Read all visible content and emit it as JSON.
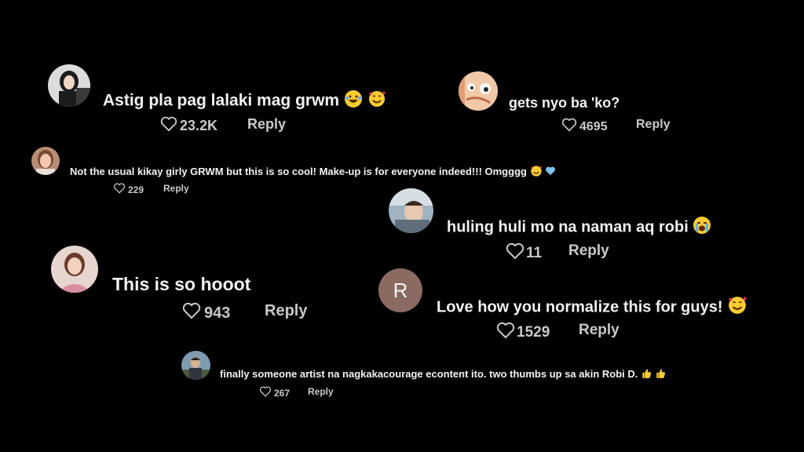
{
  "comments": [
    {
      "text": "Astig pla pag lalaki mag grwm",
      "likes": "23.2K",
      "reply": "Reply",
      "avatar": "woman-dark-hair-avatar",
      "emojis": [
        "laughing-emoji",
        "smiling-hearts-emoji"
      ]
    },
    {
      "text": "gets nyo ba 'ko?",
      "likes": "4695",
      "reply": "Reply",
      "avatar": "cartoon-face-avatar"
    },
    {
      "text": "Not the usual kikay girly GRWM but this is so cool! Make-up is for everyone indeed!!! Omgggg",
      "likes": "229",
      "reply": "Reply",
      "avatar": "woman-portrait-avatar",
      "emojis": [
        "smiling-hearts-emoji",
        "blue-heart-emoji"
      ]
    },
    {
      "text": "huling huli mo na naman aq robi",
      "likes": "11",
      "reply": "Reply",
      "avatar": "person-selfie-avatar",
      "emojis": [
        "crying-emoji"
      ]
    },
    {
      "text": "This is so hooot",
      "likes": "943",
      "reply": "Reply",
      "avatar": "woman-pink-avatar"
    },
    {
      "text": "Love how you normalize this for guys!",
      "likes": "1529",
      "reply": "Reply",
      "avatar": "letter-avatar",
      "avatar_letter": "R",
      "avatar_color": "#8a6a61",
      "emojis": [
        "smiling-hearts-emoji"
      ]
    },
    {
      "text": "finally someone artist na nagkakacourage econtent ito. two thumbs up sa akin Robi D.",
      "likes": "267",
      "reply": "Reply",
      "avatar": "man-outdoor-avatar",
      "emojis": [
        "thumbs-up-emoji",
        "thumbs-up-emoji"
      ]
    }
  ],
  "colors": {
    "background": "#000000",
    "text": "#f2f2f2",
    "meta": "#c9c9c9"
  }
}
